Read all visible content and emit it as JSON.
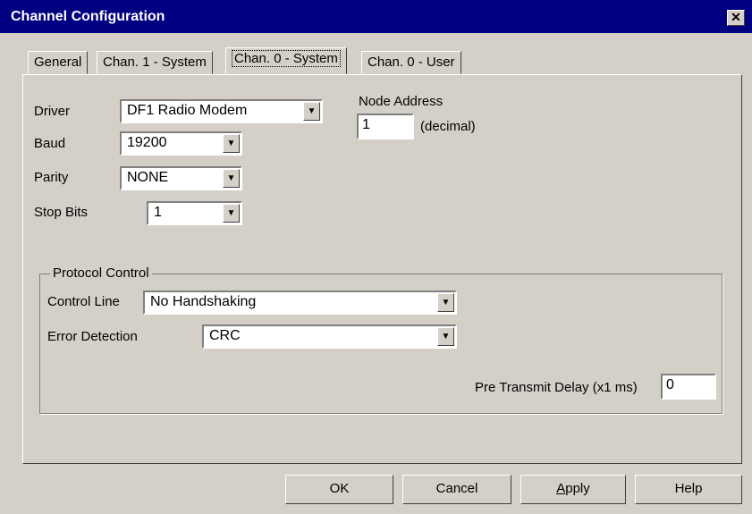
{
  "window": {
    "title": "Channel Configuration",
    "close_glyph": "✕"
  },
  "tabs": [
    {
      "label": "General"
    },
    {
      "label": "Chan. 1 - System"
    },
    {
      "label": "Chan. 0 - System"
    },
    {
      "label": "Chan. 0 - User"
    }
  ],
  "driver": {
    "label": "Driver",
    "value": "DF1 Radio Modem"
  },
  "baud": {
    "label": "Baud",
    "value": "19200"
  },
  "parity": {
    "label": "Parity",
    "value": "NONE"
  },
  "stop_bits": {
    "label": "Stop Bits",
    "value": "1"
  },
  "node_address": {
    "label": "Node Address",
    "value": "1",
    "unit": "(decimal)"
  },
  "protocol_control": {
    "legend": "Protocol Control",
    "control_line": {
      "label": "Control Line",
      "value": "No Handshaking"
    },
    "error_detection": {
      "label": "Error Detection",
      "value": "CRC"
    },
    "pre_transmit_delay": {
      "label": "Pre Transmit Delay (x1 ms)",
      "value": "0"
    }
  },
  "buttons": {
    "ok": "OK",
    "cancel": "Cancel",
    "apply_prefix": "",
    "apply_mnemonic": "A",
    "apply_rest": "pply",
    "help": "Help"
  },
  "dropdown_arrow_glyph": "▼"
}
